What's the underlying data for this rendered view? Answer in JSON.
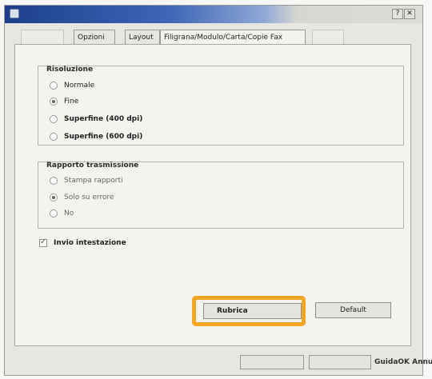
{
  "window": {
    "help_glyph": "?",
    "close_glyph": "✕"
  },
  "tabs": [
    {
      "label": "Opzioni"
    },
    {
      "label": "Layout"
    },
    {
      "label": "Filigrana/Modulo/Carta/Copie Fax"
    }
  ],
  "resolution": {
    "title": "Risoluzione",
    "options": [
      {
        "label": "Normale",
        "selected": false
      },
      {
        "label": "Fine",
        "selected": true
      },
      {
        "label": "Superfine (400 dpi)",
        "selected": false
      },
      {
        "label": "Superfine (600 dpi)",
        "selected": false
      }
    ]
  },
  "report": {
    "title": "Rapporto trasmissione",
    "options": [
      {
        "label": "Stampa rapporti",
        "selected": false
      },
      {
        "label": "Solo su errore",
        "selected": true
      },
      {
        "label": "No",
        "selected": false
      }
    ]
  },
  "header_checkbox": {
    "label": "Invio intestazione",
    "checked": true
  },
  "buttons": {
    "rubrica": "Rubrica",
    "default": "Default"
  },
  "branding": {
    "text": "GuidaOK Annulla"
  },
  "colors": {
    "highlight": "#f5a623",
    "titlebar_start": "#1b3f8c"
  }
}
